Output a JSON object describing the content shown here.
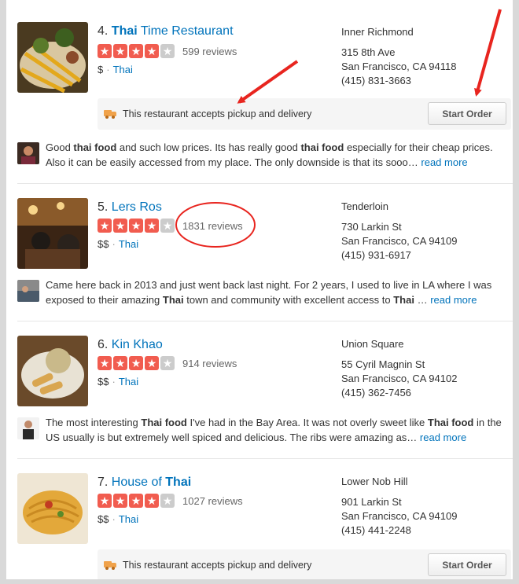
{
  "results": [
    {
      "number": "4.",
      "name_bold": "Thai",
      "name_rest": " Time Restaurant",
      "rating": 4,
      "reviews": "599 reviews",
      "price": "$",
      "category": "Thai",
      "neighborhood": "Inner Richmond",
      "address1": "315 8th Ave",
      "address2": "San Francisco, CA 94118",
      "phone": "(415) 831-3663",
      "banner_text": "This restaurant accepts pickup and delivery",
      "order_label": "Start Order",
      "snippet_parts": [
        {
          "t": "Good "
        },
        {
          "t": "thai food",
          "b": true
        },
        {
          "t": " and such low prices. Its has really good "
        },
        {
          "t": "thai food",
          "b": true
        },
        {
          "t": " especially for their cheap prices. Also it can be easily accessed from my place. The only downside is that its sooo… "
        }
      ],
      "read_more": "read more"
    },
    {
      "number": "5.",
      "name_bold": "",
      "name_rest": "Lers Ros",
      "rating": 4,
      "reviews": "1831 reviews",
      "price": "$$",
      "category": "Thai",
      "neighborhood": "Tenderloin",
      "address1": "730 Larkin St",
      "address2": "San Francisco, CA 94109",
      "phone": "(415) 931-6917",
      "snippet_parts": [
        {
          "t": "Came here back in 2013 and just went back last night. For 2 years, I used to live in LA where I was exposed to their amazing "
        },
        {
          "t": "Thai",
          "b": true
        },
        {
          "t": " town and community with excellent access to "
        },
        {
          "t": "Thai",
          "b": true
        },
        {
          "t": " … "
        }
      ],
      "read_more": "read more"
    },
    {
      "number": "6.",
      "name_bold": "",
      "name_rest": "Kin Khao",
      "rating": 4,
      "reviews": "914 reviews",
      "price": "$$",
      "category": "Thai",
      "neighborhood": "Union Square",
      "address1": "55 Cyril Magnin St",
      "address2": "San Francisco, CA 94102",
      "phone": "(415) 362-7456",
      "snippet_parts": [
        {
          "t": "The most interesting "
        },
        {
          "t": "Thai food",
          "b": true
        },
        {
          "t": " I've had in the Bay Area. It was not overly sweet like "
        },
        {
          "t": "Thai food",
          "b": true
        },
        {
          "t": " in the US usually is but extremely well spiced and delicious. The ribs were amazing as… "
        }
      ],
      "read_more": "read more"
    },
    {
      "number": "7.",
      "name_bold_suffix": "Thai",
      "name_rest": "House of ",
      "rating": 4,
      "reviews": "1027 reviews",
      "price": "$$",
      "category": "Thai",
      "neighborhood": "Lower Nob Hill",
      "address1": "901 Larkin St",
      "address2": "San Francisco, CA 94109",
      "phone": "(415) 441-2248",
      "banner_text": "This restaurant accepts pickup and delivery",
      "order_label": "Start Order"
    }
  ],
  "star_glyph": "★",
  "colors": {
    "star_on": "#f15c4f",
    "link": "#0073bb",
    "annotation": "#e8251f"
  }
}
